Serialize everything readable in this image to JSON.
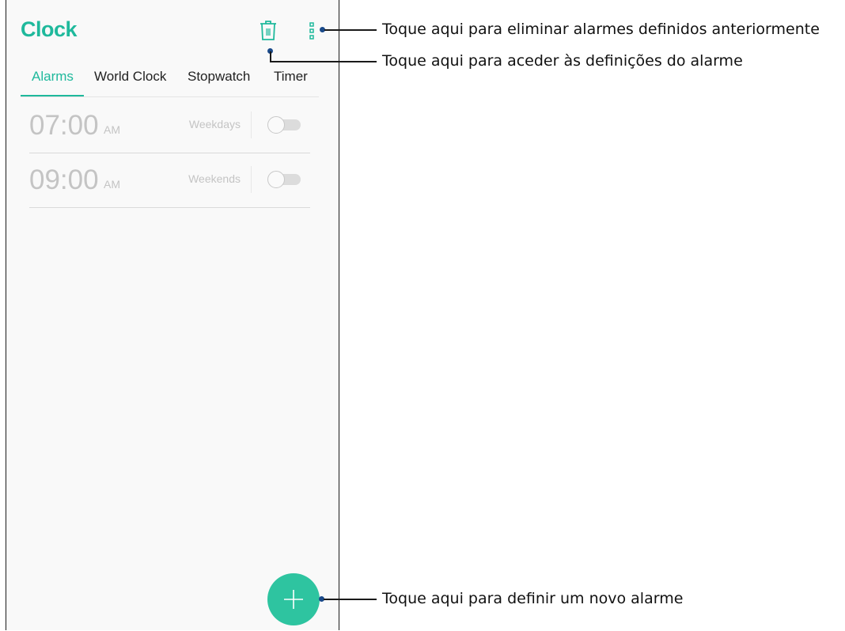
{
  "app": {
    "title": "Clock",
    "accent_color": "#1fb99c",
    "fab_color": "#2ec4a0"
  },
  "toolbar": {
    "delete_icon": "trash-icon",
    "menu_icon": "more-vert-icon"
  },
  "tabs": [
    {
      "label": "Alarms",
      "active": true
    },
    {
      "label": "World Clock",
      "active": false
    },
    {
      "label": "Stopwatch",
      "active": false
    },
    {
      "label": "Timer",
      "active": false
    }
  ],
  "alarms": [
    {
      "time": "07:00",
      "ampm": "AM",
      "repeat": "Weekdays",
      "enabled": false
    },
    {
      "time": "09:00",
      "ampm": "AM",
      "repeat": "Weekends",
      "enabled": false
    }
  ],
  "fab": {
    "icon": "plus-icon"
  },
  "annotations": {
    "delete": "Toque aqui para eliminar alarmes definidos anteriormente",
    "settings": "Toque aqui para aceder às definições do alarme",
    "new_alarm": "Toque aqui para definir um novo alarme"
  }
}
